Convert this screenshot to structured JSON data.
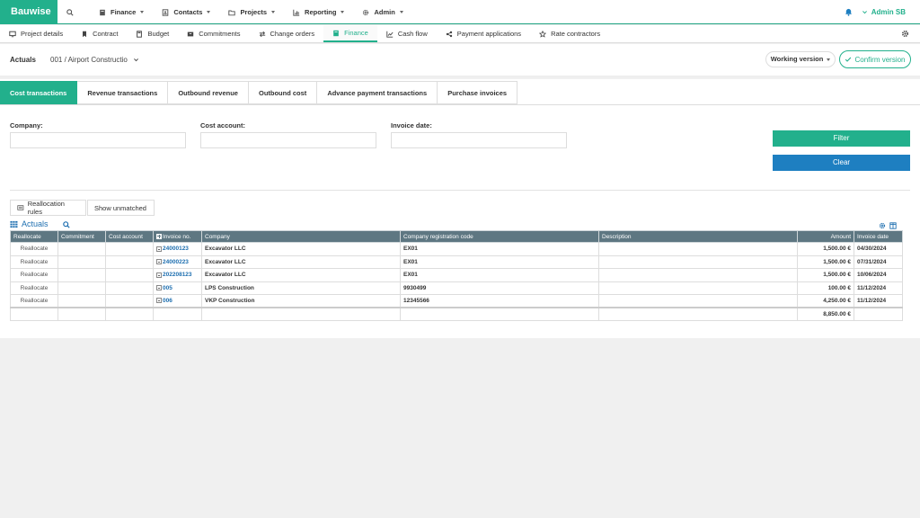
{
  "app": {
    "brand": "Bauwise"
  },
  "topnav": {
    "items": [
      {
        "label": "Finance"
      },
      {
        "label": "Contacts"
      },
      {
        "label": "Projects"
      },
      {
        "label": "Reporting"
      },
      {
        "label": "Admin"
      }
    ],
    "user": "Admin SB"
  },
  "subnav": {
    "items": [
      {
        "label": "Project details"
      },
      {
        "label": "Contract"
      },
      {
        "label": "Budget"
      },
      {
        "label": "Commitments"
      },
      {
        "label": "Change orders"
      },
      {
        "label": "Finance"
      },
      {
        "label": "Cash flow"
      },
      {
        "label": "Payment applications"
      },
      {
        "label": "Rate contractors"
      }
    ],
    "active": "Finance"
  },
  "header": {
    "title": "Actuals",
    "project": "001 / Airport Constructio",
    "working_version": "Working version",
    "confirm_version": "Confirm version"
  },
  "tabs": [
    {
      "label": "Cost transactions",
      "active": true
    },
    {
      "label": "Revenue transactions"
    },
    {
      "label": "Outbound revenue"
    },
    {
      "label": "Outbound cost"
    },
    {
      "label": "Advance payment transactions"
    },
    {
      "label": "Purchase invoices"
    }
  ],
  "filters": {
    "company_label": "Company:",
    "cost_account_label": "Cost account:",
    "invoice_date_label": "Invoice date:",
    "company_value": "",
    "cost_account_value": "",
    "invoice_date_value": "",
    "filter_button": "Filter",
    "clear_button": "Clear"
  },
  "toolbar": {
    "reallocation_rules": "Reallocation rules",
    "show_unmatched": "Show unmatched"
  },
  "grid": {
    "title": "Actuals",
    "columns": [
      "Reallocate",
      "Commitment",
      "Cost account",
      "Invoice no.",
      "Company",
      "Company registration code",
      "Description",
      "Amount",
      "Invoice date"
    ],
    "rows": [
      {
        "reallocate": "Reallocate",
        "commitment": "",
        "cost_account": "",
        "invoice_no": "24000123",
        "company": "Excavator LLC",
        "reg_code": "EX01",
        "description": "",
        "amount": "1,500.00 €",
        "invoice_date": "04/30/2024"
      },
      {
        "reallocate": "Reallocate",
        "commitment": "",
        "cost_account": "",
        "invoice_no": "24000223",
        "company": "Excavator LLC",
        "reg_code": "EX01",
        "description": "",
        "amount": "1,500.00 €",
        "invoice_date": "07/31/2024"
      },
      {
        "reallocate": "Reallocate",
        "commitment": "",
        "cost_account": "",
        "invoice_no": "202208123",
        "company": "Excavator LLC",
        "reg_code": "EX01",
        "description": "",
        "amount": "1,500.00 €",
        "invoice_date": "10/06/2024"
      },
      {
        "reallocate": "Reallocate",
        "commitment": "",
        "cost_account": "",
        "invoice_no": "005",
        "company": "LPS Construction",
        "reg_code": "9930499",
        "description": "",
        "amount": "100.00 €",
        "invoice_date": "11/12/2024"
      },
      {
        "reallocate": "Reallocate",
        "commitment": "",
        "cost_account": "",
        "invoice_no": "006",
        "company": "VKP Construction",
        "reg_code": "12345566",
        "description": "",
        "amount": "4,250.00 €",
        "invoice_date": "11/12/2024"
      }
    ],
    "total_amount": "8,850.00 €"
  },
  "colors": {
    "accent": "#22b08c",
    "blue": "#1e7fc1",
    "header_bg": "#5e7782"
  }
}
